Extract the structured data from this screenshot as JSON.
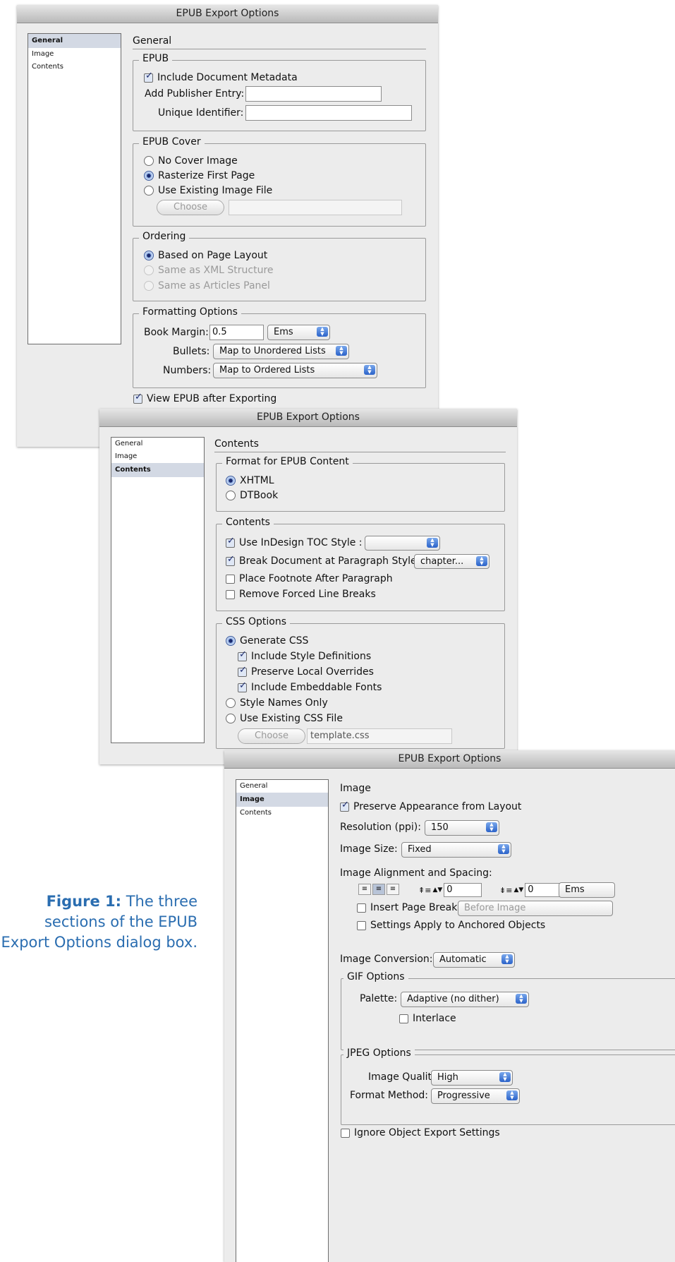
{
  "caption": {
    "bold": "Figure 1:",
    "text": "The three sections of the EPUB Export Options dialog box."
  },
  "win1": {
    "title": "EPUB Export Options",
    "sidebar": [
      "General",
      "Image",
      "Contents"
    ],
    "section": "General",
    "epub": {
      "legend": "EPUB",
      "include_metadata": "Include Document Metadata",
      "publisher_label": "Add Publisher Entry:",
      "publisher_value": "",
      "uid_label": "Unique Identifier:",
      "uid_value": ""
    },
    "cover": {
      "legend": "EPUB Cover",
      "no_cover": "No Cover Image",
      "rasterize": "Rasterize First Page",
      "existing": "Use Existing Image File",
      "choose": "Choose"
    },
    "ordering": {
      "legend": "Ordering",
      "page_layout": "Based on Page Layout",
      "xml": "Same as XML Structure",
      "articles": "Same as Articles Panel"
    },
    "formatting": {
      "legend": "Formatting Options",
      "book_margin_label": "Book Margin:",
      "book_margin_value": "0.5",
      "unit": "Ems",
      "bullets_label": "Bullets:",
      "bullets_value": "Map to Unordered Lists",
      "numbers_label": "Numbers:",
      "numbers_value": "Map to Ordered Lists"
    },
    "view_after": "View EPUB after Exporting"
  },
  "win2": {
    "title": "EPUB Export Options",
    "sidebar": [
      "General",
      "Image",
      "Contents"
    ],
    "section": "Contents",
    "format": {
      "legend": "Format for EPUB Content",
      "xhtml": "XHTML",
      "dtbook": "DTBook"
    },
    "contents": {
      "legend": "Contents",
      "toc": "Use InDesign TOC Style :",
      "toc_value": "",
      "break": "Break Document at Paragraph Style:",
      "break_value": "chapter...",
      "footnote": "Place Footnote After Paragraph",
      "forced": "Remove Forced Line Breaks"
    },
    "css": {
      "legend": "CSS Options",
      "generate": "Generate CSS",
      "style_defs": "Include Style Definitions",
      "overrides": "Preserve Local Overrides",
      "fonts": "Include Embeddable Fonts",
      "names_only": "Style Names Only",
      "existing": "Use Existing CSS File",
      "choose": "Choose",
      "file": "template.css"
    }
  },
  "win3": {
    "title": "EPUB Export Options",
    "sidebar": [
      "General",
      "Image",
      "Contents"
    ],
    "section": "Image",
    "preserve": "Preserve Appearance from Layout",
    "resolution_label": "Resolution (ppi):",
    "resolution_value": "150",
    "size_label": "Image Size:",
    "size_value": "Fixed",
    "align_label": "Image Alignment and Spacing:",
    "space_before": "0",
    "space_after": "0",
    "space_unit": "Ems",
    "page_break": "Insert Page Break:",
    "page_break_value": "Before Image",
    "anchored": "Settings Apply to Anchored Objects",
    "conversion_label": "Image Conversion:",
    "conversion_value": "Automatic",
    "gif": {
      "legend": "GIF Options",
      "palette_label": "Palette:",
      "palette_value": "Adaptive (no dither)",
      "interlace": "Interlace"
    },
    "jpeg": {
      "legend": "JPEG Options",
      "quality_label": "Image Quality:",
      "quality_value": "High",
      "method_label": "Format Method:",
      "method_value": "Progressive"
    },
    "ignore": "Ignore Object Export Settings"
  }
}
